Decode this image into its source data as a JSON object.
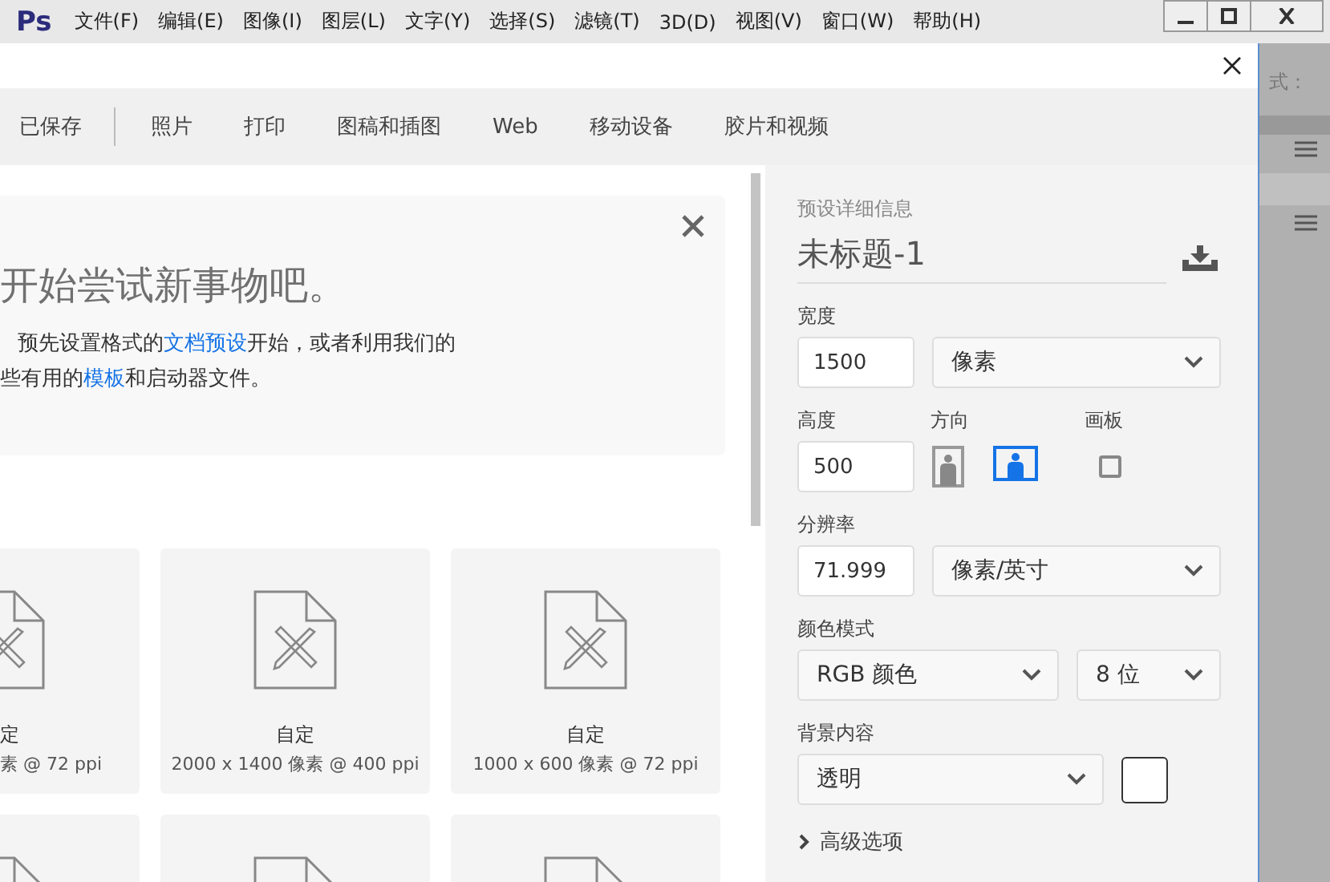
{
  "menubar": {
    "logo": "Ps",
    "menus": [
      "文件(F)",
      "编辑(E)",
      "图像(I)",
      "图层(L)",
      "文字(Y)",
      "选择(S)",
      "滤镜(T)",
      "3D(D)",
      "视图(V)",
      "窗口(W)",
      "帮助(H)"
    ]
  },
  "dialog": {
    "tabs": [
      {
        "label": "已保存"
      },
      {
        "label": "照片"
      },
      {
        "label": "打印"
      },
      {
        "label": "图稿和插图"
      },
      {
        "label": "Web"
      },
      {
        "label": "移动设备"
      },
      {
        "label": "胶片和视频"
      }
    ],
    "banner": {
      "heading": "开始尝试新事物吧。",
      "lines": [
        [
          {
            "kind": "text",
            "text": "预先设置格式的"
          },
          {
            "kind": "link",
            "text": "文档预设"
          },
          {
            "kind": "text",
            "text": "开始，或者利用我们的"
          }
        ],
        [
          {
            "kind": "text",
            "text": "些有用的"
          },
          {
            "kind": "link",
            "text": "模板"
          },
          {
            "kind": "text",
            "text": "和启动器文件。"
          }
        ]
      ]
    },
    "presets": [
      {
        "name": "定",
        "size": "素 @ 72 ppi"
      },
      {
        "name": "自定",
        "size": "2000 x 1400 像素 @ 400 ppi"
      },
      {
        "name": "自定",
        "size": "1000 x 600 像素 @ 72 ppi"
      }
    ],
    "details": {
      "heading": "预设详细信息",
      "title": "未标题-1",
      "width": {
        "label": "宽度",
        "value": "1500",
        "unit": "像素"
      },
      "height": {
        "label": "高度",
        "value": "500"
      },
      "orientation": {
        "label": "方向",
        "options": [
          {
            "kind": "portrait",
            "selected": false
          },
          {
            "kind": "landscape",
            "selected": true
          }
        ]
      },
      "artboard": {
        "label": "画板",
        "checked": false
      },
      "resolution": {
        "label": "分辨率",
        "value": "71.999",
        "unit": "像素/英寸"
      },
      "color_mode": {
        "label": "颜色模式",
        "mode": "RGB 颜色",
        "depth": "8 位"
      },
      "background": {
        "label": "背景内容",
        "value": "透明"
      },
      "advanced": {
        "label": "高级选项",
        "expanded": false
      }
    }
  },
  "side_panel": {
    "label": "式："
  }
}
